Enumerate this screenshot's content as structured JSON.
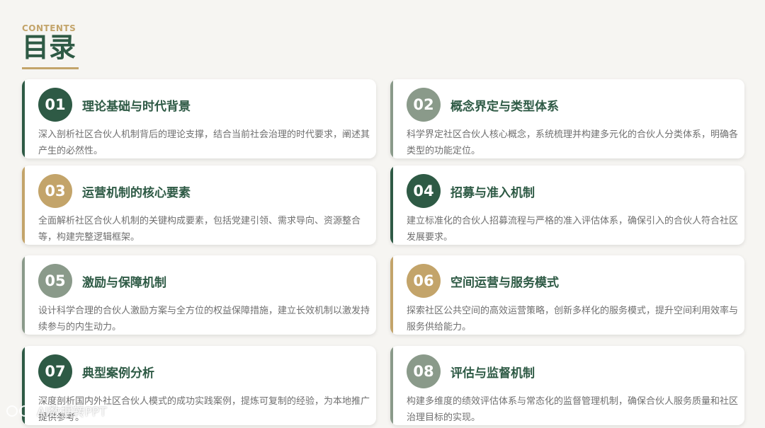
{
  "header": {
    "contents_label": "CONTENTS",
    "title": "目录"
  },
  "colors": {
    "dark_green": "#2e5a45",
    "sage": "#8a9a8a",
    "gold": "#c3a46a"
  },
  "items": [
    {
      "number": "01",
      "title": "理论基础与时代背景",
      "description": "深入剖析社区合伙人机制背后的理论支撑，结合当前社会治理的时代要求，阐述其产生的必然性。",
      "color": "#2e5a45"
    },
    {
      "number": "02",
      "title": "概念界定与类型体系",
      "description": "科学界定社区合伙人核心概念，系统梳理并构建多元化的合伙人分类体系，明确各类型的功能定位。",
      "color": "#8a9a8a"
    },
    {
      "number": "03",
      "title": "运营机制的核心要素",
      "description": "全面解析社区合伙人机制的关键构成要素，包括党建引领、需求导向、资源整合等，构建完整逻辑框架。",
      "color": "#c3a46a"
    },
    {
      "number": "04",
      "title": "招募与准入机制",
      "description": "建立标准化的合伙人招募流程与严格的准入评估体系，确保引入的合伙人符合社区发展要求。",
      "color": "#2e5a45"
    },
    {
      "number": "05",
      "title": "激励与保障机制",
      "description": "设计科学合理的合伙人激励方案与全方位的权益保障措施，建立长效机制以激发持续参与的内生动力。",
      "color": "#8a9a8a"
    },
    {
      "number": "06",
      "title": "空间运营与服务模式",
      "description": "探索社区公共空间的高效运营策略，创新多样化的服务模式，提升空间利用效率与服务供给能力。",
      "color": "#c3a46a"
    },
    {
      "number": "07",
      "title": "典型案例分析",
      "description": "深度剖析国内外社区合伙人模式的成功实践案例，提炼可复制的经验，为本地推广提供参考。",
      "color": "#2e5a45"
    },
    {
      "number": "08",
      "title": "评估与监督机制",
      "description": "构建多维度的绩效评估体系与常态化的监督管理机制，确保合伙人服务质量和社区治理目标的实现。",
      "color": "#8a9a8a"
    }
  ],
  "watermark": {
    "text": "AI数据转PPT",
    "icon": "logo-icon"
  }
}
